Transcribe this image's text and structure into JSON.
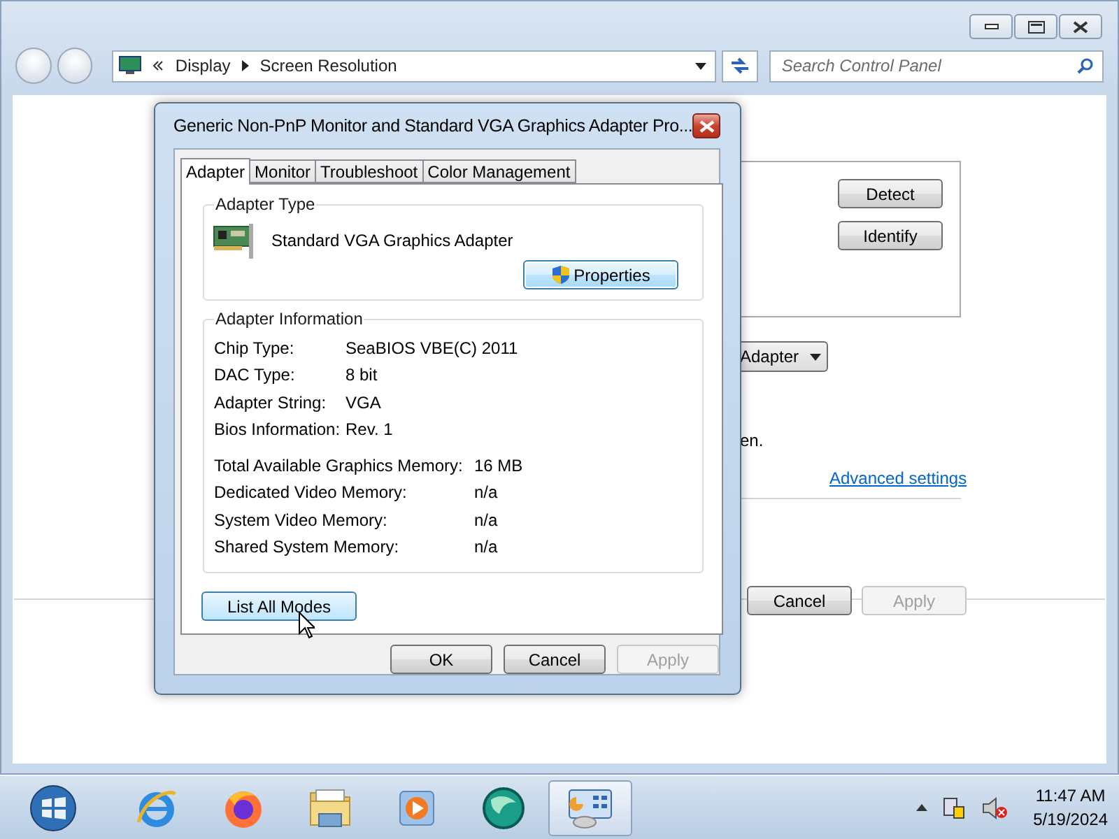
{
  "window": {
    "breadcrumb": [
      "Display",
      "Screen Resolution"
    ],
    "search": {
      "placeholder": "Search Control Panel"
    }
  },
  "background": {
    "buttons": [
      "Detect",
      "Identify"
    ],
    "dropdown": "Adapter",
    "note": "en.",
    "link": "Advanced settings",
    "footer_buttons": [
      {
        "label": "Cancel",
        "disabled": false
      },
      {
        "label": "Apply",
        "disabled": true
      }
    ]
  },
  "dialog": {
    "title": "Generic Non-PnP Monitor and Standard VGA Graphics Adapter Pro...",
    "tabs": [
      {
        "label": "Adapter",
        "selected": true
      },
      {
        "label": "Monitor",
        "selected": false
      },
      {
        "label": "Troubleshoot",
        "selected": false
      },
      {
        "label": "Color Management",
        "selected": false
      }
    ],
    "adapter_type": {
      "heading": "Adapter Type",
      "name": "Standard VGA Graphics Adapter",
      "button": "Properties"
    },
    "adapter_info": {
      "heading": "Adapter Information",
      "rows": [
        {
          "label": "Chip Type:",
          "value": "SeaBIOS VBE(C) 2011"
        },
        {
          "label": "DAC Type:",
          "value": "8 bit"
        },
        {
          "label": "Adapter String:",
          "value": "VGA"
        },
        {
          "label": "Bios Information:",
          "value": "Rev. 1"
        }
      ],
      "memory_rows": [
        {
          "label": "Total Available Graphics Memory:",
          "value": "16 MB"
        },
        {
          "label": "Dedicated Video Memory:",
          "value": "n/a"
        },
        {
          "label": "System Video Memory:",
          "value": "n/a"
        },
        {
          "label": "Shared System Memory:",
          "value": "n/a"
        }
      ]
    },
    "list_button": "List All Modes",
    "buttons": [
      {
        "label": "OK",
        "disabled": false
      },
      {
        "label": "Cancel",
        "disabled": false
      },
      {
        "label": "Apply",
        "disabled": true
      }
    ]
  },
  "taskbar": {
    "apps": [
      {
        "kind": "browser",
        "selected": false
      },
      {
        "kind": "firefox",
        "selected": false
      },
      {
        "kind": "folder",
        "selected": false
      },
      {
        "kind": "media",
        "selected": false
      },
      {
        "kind": "globe",
        "selected": false
      },
      {
        "kind": "control",
        "selected": true
      }
    ],
    "clock": {
      "time": "11:47 AM",
      "date": "5/19/2024"
    }
  }
}
